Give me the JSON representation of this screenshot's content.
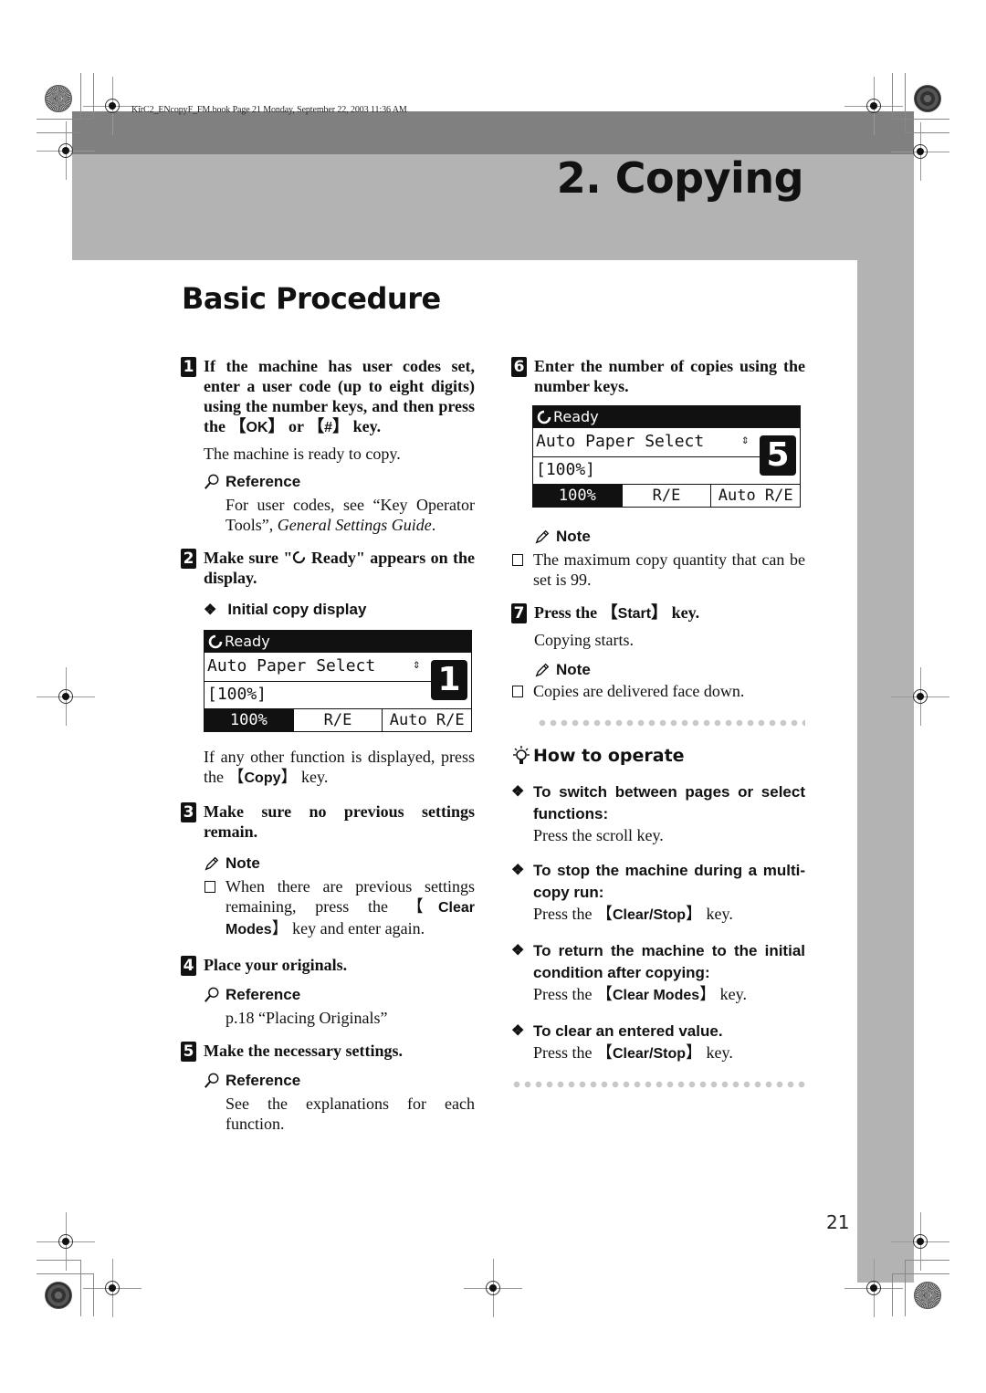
{
  "header": {
    "file_info": "KirC2_ENcopyF_FM.book  Page 21  Monday, September 22, 2003  11:36 AM",
    "chapter_title": "2. Copying",
    "section_title": "Basic Procedure"
  },
  "steps": [
    {
      "number": "1",
      "title_parts": [
        "If the machine has user codes set, enter a user code (up to eight digits) using the number keys, and then press the ",
        "OK",
        " or ",
        "#",
        " key."
      ],
      "body": "The machine is ready to copy.",
      "reference": {
        "label": "Reference",
        "text_prefix": "For user codes, see “Key Operator Tools”, ",
        "text_italic": "General Settings Guide",
        "text_suffix": "."
      }
    },
    {
      "number": "2",
      "title_prefix": "Make sure \"",
      "title_suffix": " Ready\" appears on the display.",
      "subhead": "Initial copy display",
      "body_prefix": "If any other function is displayed, press the ",
      "body_key": "Copy",
      "body_suffix": " key."
    },
    {
      "number": "3",
      "title": "Make sure no previous settings remain.",
      "note": {
        "label": "Note",
        "item_prefix": "When there are previous settings remaining, press the ",
        "item_key": "Clear Modes",
        "item_suffix": " key and enter again."
      }
    },
    {
      "number": "4",
      "title": "Place your originals.",
      "reference": {
        "label": "Reference",
        "text": "p.18 “Placing Originals”"
      }
    },
    {
      "number": "5",
      "title": "Make the necessary settings.",
      "reference": {
        "label": "Reference",
        "text": "See the explanations for each function."
      }
    },
    {
      "number": "6",
      "title": "Enter the number of copies using the number keys.",
      "note": {
        "label": "Note",
        "item": "The maximum copy quantity that can be set is 99."
      }
    },
    {
      "number": "7",
      "title_prefix": "Press the ",
      "title_key": "Start",
      "title_suffix": " key.",
      "body": "Copying starts.",
      "note": {
        "label": "Note",
        "item": "Copies are delivered face down."
      }
    }
  ],
  "lcd_displays": [
    {
      "status": "Ready",
      "line1": "Auto Paper Select",
      "line2": "[100%]",
      "copy_count": "1",
      "tabs": [
        "100%",
        "R/E",
        "Auto R/E"
      ]
    },
    {
      "status": "Ready",
      "line1": "Auto Paper Select",
      "line2": "[100%]",
      "copy_count": "5",
      "tabs": [
        "100%",
        "R/E",
        "Auto R/E"
      ]
    }
  ],
  "how_to_operate": {
    "title": "How to operate",
    "items": [
      {
        "heading": "To switch between pages or select functions:",
        "text_prefix": "Press the scroll key.",
        "key": "",
        "text_suffix": ""
      },
      {
        "heading": "To stop the machine during a multi-copy run:",
        "text_prefix": "Press the ",
        "key": "Clear/Stop",
        "text_suffix": " key."
      },
      {
        "heading": "To return the machine to the initial condition after copying:",
        "text_prefix": "Press the ",
        "key": "Clear Modes",
        "text_suffix": " key."
      },
      {
        "heading": "To clear an entered value.",
        "text_prefix": "Press the ",
        "key": "Clear/Stop",
        "text_suffix": " key."
      }
    ]
  },
  "page_number": "21",
  "symbols": {
    "bracket_open": "【",
    "bracket_close": "】",
    "diamond": "❖",
    "updown": "⇕"
  }
}
